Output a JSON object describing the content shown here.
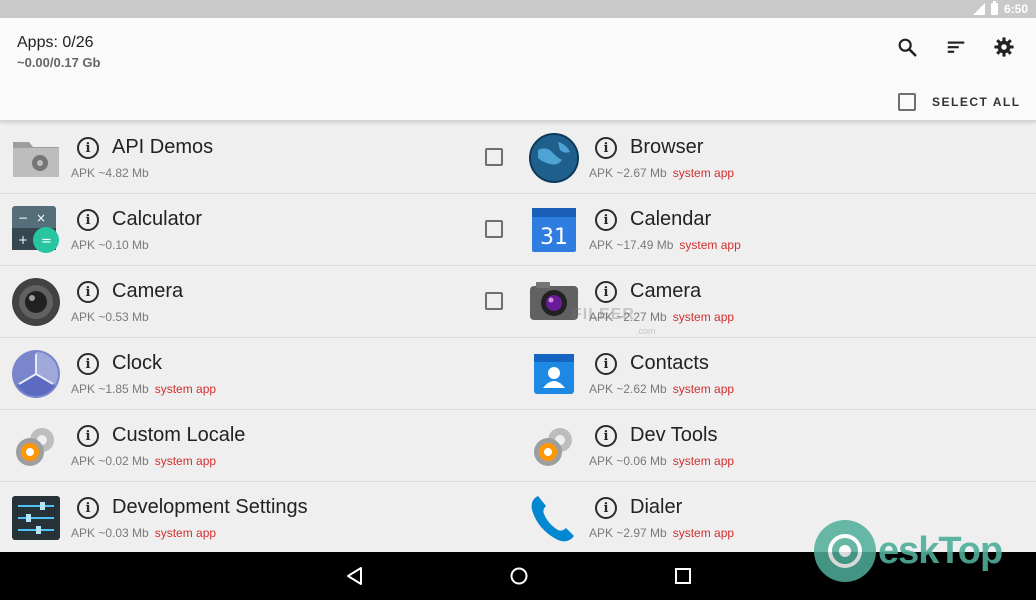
{
  "status_bar": {
    "time": "6:50"
  },
  "header": {
    "apps_count": "Apps: 0/26",
    "apps_size": "~0.00/0.17 Gb",
    "select_all_label": "SELECT ALL"
  },
  "apps": [
    {
      "name": "API Demos",
      "meta": "APK ~4.82 Mb",
      "tag": "",
      "icon": "folder-gear-icon",
      "checkbox": true
    },
    {
      "name": "Browser",
      "meta": "APK ~2.67 Mb",
      "tag": "system app",
      "icon": "globe-icon",
      "checkbox": false
    },
    {
      "name": "Calculator",
      "meta": "APK ~0.10 Mb",
      "tag": "",
      "icon": "calculator-icon",
      "checkbox": true
    },
    {
      "name": "Calendar",
      "meta": "APK ~17.49 Mb",
      "tag": "system app",
      "icon": "calendar-icon",
      "checkbox": false
    },
    {
      "name": "Camera",
      "meta": "APK ~0.53 Mb",
      "tag": "",
      "icon": "camera-lens-icon",
      "checkbox": true
    },
    {
      "name": "Camera",
      "meta": "APK ~2.27 Mb",
      "tag": "system app",
      "icon": "camera-icon",
      "checkbox": false
    },
    {
      "name": "Clock",
      "meta": "APK ~1.85 Mb",
      "tag": "system app",
      "icon": "clock-icon",
      "checkbox": false
    },
    {
      "name": "Contacts",
      "meta": "APK ~2.62 Mb",
      "tag": "system app",
      "icon": "contacts-icon",
      "checkbox": false
    },
    {
      "name": "Custom Locale",
      "meta": "APK ~0.02 Mb",
      "tag": "system app",
      "icon": "gear-icon",
      "checkbox": false
    },
    {
      "name": "Dev Tools",
      "meta": "APK ~0.06 Mb",
      "tag": "system app",
      "icon": "gear-icon",
      "checkbox": false
    },
    {
      "name": "Development Settings",
      "meta": "APK ~0.03 Mb",
      "tag": "system app",
      "icon": "sliders-icon",
      "checkbox": false
    },
    {
      "name": "Dialer",
      "meta": "APK ~2.97 Mb",
      "tag": "system app",
      "icon": "phone-icon",
      "checkbox": false
    }
  ],
  "watermark": {
    "text": "eskTop",
    "overlay": "FILEER",
    "overlay_sub": ".com"
  },
  "colors": {
    "system_tag": "#d32f2f",
    "appbar": "#fafafa",
    "navbar": "#000000"
  }
}
